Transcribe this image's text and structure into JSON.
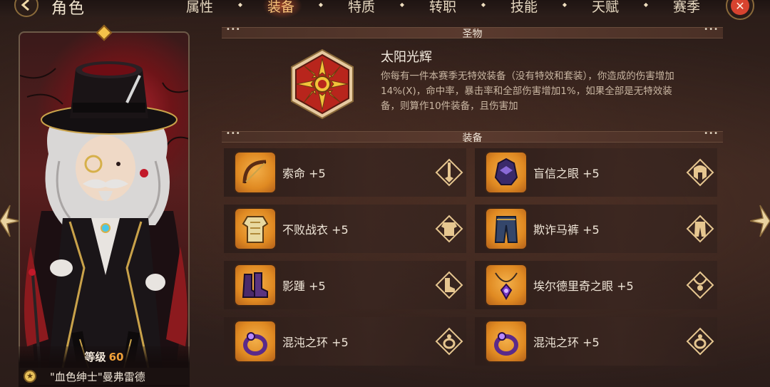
{
  "header": {
    "title": "角色",
    "tabs": [
      {
        "label": "属性",
        "active": false
      },
      {
        "label": "装备",
        "active": true
      },
      {
        "label": "特质",
        "active": false
      },
      {
        "label": "转职",
        "active": false
      },
      {
        "label": "技能",
        "active": false
      },
      {
        "label": "天赋",
        "active": false
      },
      {
        "label": "赛季",
        "active": false
      }
    ],
    "close_icon": "close-icon",
    "back_icon": "back-arrow-icon"
  },
  "character": {
    "level_label": "等级",
    "level": "60",
    "name": "\"血色绅士\"曼弗雷德",
    "badge_icon": "star-icon"
  },
  "relic_section": {
    "title": "圣物",
    "relic": {
      "name": "太阳光辉",
      "icon": "sun-radiance-icon",
      "description": "你每有一件本赛季无特效装备（没有特效和套装），你造成的伤害增加14%(X)，命中率，暴击率和全部伤害增加1%，如果全部是无特效装备，则算作10件装备，且伤害加"
    }
  },
  "equipment_section": {
    "title": "装备",
    "items": [
      {
        "name": "索命 +5",
        "icon": "bow-icon",
        "slot_icon": "weapon-slot-icon"
      },
      {
        "name": "盲信之眼 +5",
        "icon": "helmet-icon",
        "slot_icon": "helmet-slot-icon"
      },
      {
        "name": "不败战衣 +5",
        "icon": "armor-icon",
        "slot_icon": "armor-slot-icon"
      },
      {
        "name": "欺诈马裤 +5",
        "icon": "pants-icon",
        "slot_icon": "pants-slot-icon"
      },
      {
        "name": "影踵 +5",
        "icon": "boots-icon",
        "slot_icon": "boots-slot-icon"
      },
      {
        "name": "埃尔德里奇之眼 +5",
        "icon": "necklace-icon",
        "slot_icon": "necklace-slot-icon"
      },
      {
        "name": "混沌之环 +5",
        "icon": "ring-icon",
        "slot_icon": "ring-slot-icon"
      },
      {
        "name": "混沌之环 +5",
        "icon": "ring-icon",
        "slot_icon": "ring-slot-icon"
      }
    ]
  },
  "colors": {
    "accent_gold": "#f2a23a",
    "active_tab": "#f6c27a",
    "close_red": "#d8432f"
  }
}
